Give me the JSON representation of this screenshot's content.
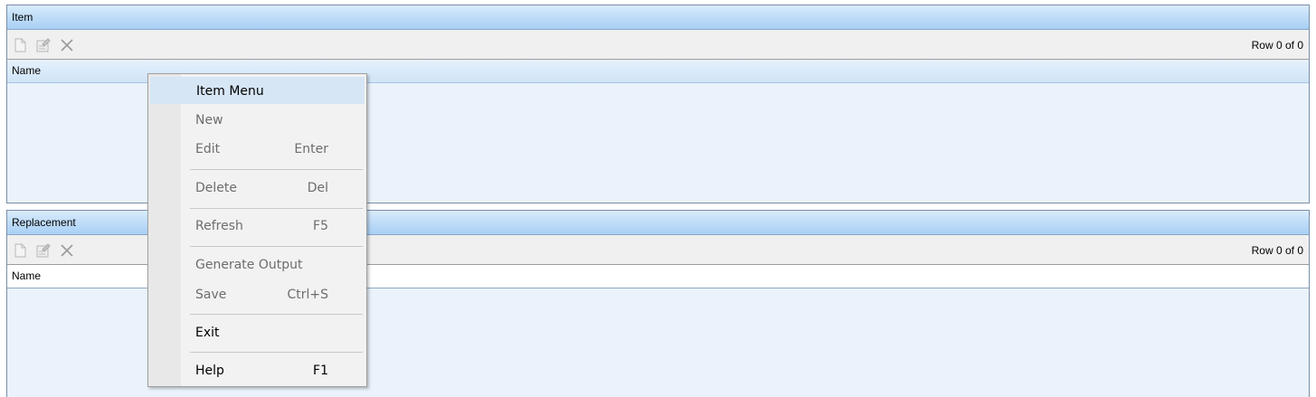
{
  "item_panel": {
    "title": "Item",
    "row_count": "Row 0 of 0",
    "column_header": "Name"
  },
  "replacement_panel": {
    "title": "Replacement",
    "row_count": "Row 0 of 0",
    "column_header": "Name"
  },
  "toolbar_icons": [
    "new-icon",
    "properties-icon",
    "delete-icon"
  ],
  "context_menu": {
    "title": "Item Menu",
    "items": [
      {
        "label": "New",
        "shortcut": "",
        "enabled": false
      },
      {
        "label": "Edit",
        "shortcut": "Enter",
        "enabled": false
      },
      {
        "label": "Delete",
        "shortcut": "Del",
        "enabled": false
      },
      {
        "label": "Refresh",
        "shortcut": "F5",
        "enabled": false
      },
      {
        "label": "Generate Output",
        "shortcut": "",
        "enabled": false
      },
      {
        "label": "Save",
        "shortcut": "Ctrl+S",
        "enabled": false
      },
      {
        "label": "Exit",
        "shortcut": "",
        "enabled": true
      },
      {
        "label": "Help",
        "shortcut": "F1",
        "enabled": true
      }
    ]
  },
  "colors": {
    "header_gradient_bottom": "#a9d0f5",
    "panel_background": "#eaf3fc",
    "menu_highlight": "#d7e6f5"
  }
}
